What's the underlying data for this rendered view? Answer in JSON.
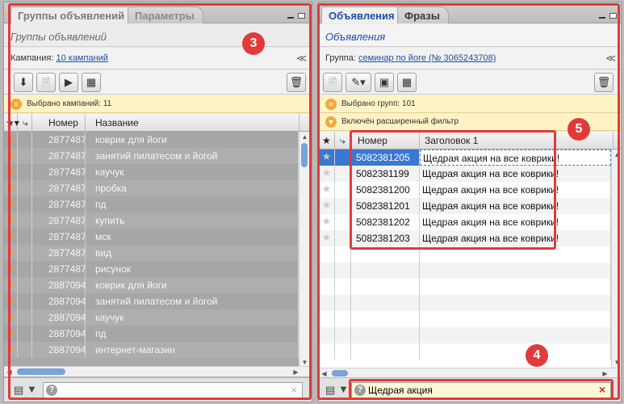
{
  "left": {
    "tabs": [
      "Группы объявлений",
      "Параметры"
    ],
    "subtitle": "Группы объявлений",
    "filter_label": "Кампания:",
    "filter_value": "10 кампаний",
    "info_text": "Выбрано кампаний: 11",
    "columns": [
      "Номер",
      "Название"
    ],
    "rows": [
      {
        "id": "2877487",
        "name": "коврик для йоги"
      },
      {
        "id": "2877487",
        "name": "занятий пилатесом и йогой"
      },
      {
        "id": "2877487",
        "name": "каучук"
      },
      {
        "id": "2877487",
        "name": "пробка"
      },
      {
        "id": "2877487",
        "name": "пд"
      },
      {
        "id": "2877487",
        "name": "купить"
      },
      {
        "id": "2877487",
        "name": "мск"
      },
      {
        "id": "2877487",
        "name": "вид"
      },
      {
        "id": "2877487",
        "name": "рисунок"
      },
      {
        "id": "2887094",
        "name": "коврик для йоги"
      },
      {
        "id": "2887094",
        "name": "занятий пилатесом и йогой"
      },
      {
        "id": "2887094",
        "name": "каучук"
      },
      {
        "id": "2887094",
        "name": "пд"
      },
      {
        "id": "2887094",
        "name": "интернет-магазин"
      }
    ],
    "search_value": ""
  },
  "right": {
    "tabs": [
      "Объявления",
      "Фразы"
    ],
    "subtitle": "Объявления",
    "filter_label": "Группа:",
    "filter_value": "семинар по йоге (№ 3065243708)",
    "info_text": "Выбрано групп: 101",
    "filter_info": "Включён расширенный фильтр",
    "columns": [
      "Номер",
      "Заголовок 1"
    ],
    "rows": [
      {
        "id": "5082381205",
        "title": "Щедрая акция на все коврики!"
      },
      {
        "id": "5082381199",
        "title": "Щедрая акция на все коврики!"
      },
      {
        "id": "5082381200",
        "title": "Щедрая акция на все коврики!"
      },
      {
        "id": "5082381201",
        "title": "Щедрая акция на все коврики!"
      },
      {
        "id": "5082381202",
        "title": "Щедрая акция на все коврики!"
      },
      {
        "id": "5082381203",
        "title": "Щедрая акция на все коврики!"
      }
    ],
    "search_value": "Щедрая акция"
  },
  "badges": [
    "3",
    "4",
    "5"
  ],
  "colors": {
    "annotation_red": "#e23a3a",
    "accent_blue": "#1d4fa8",
    "star_orange": "#f29b1a",
    "info_yellow": "#fff3c6"
  }
}
